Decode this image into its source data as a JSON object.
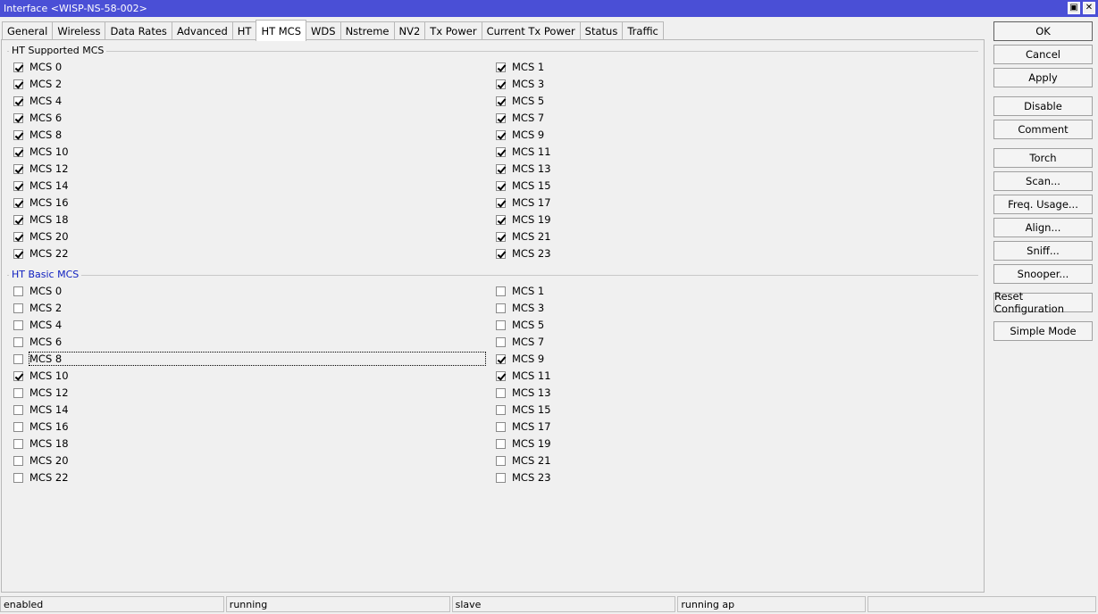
{
  "window": {
    "title": "Interface <WISP-NS-58-002>",
    "restore_glyph": "▣",
    "close_glyph": "✕"
  },
  "tabs": [
    {
      "label": "General",
      "active": false
    },
    {
      "label": "Wireless",
      "active": false
    },
    {
      "label": "Data Rates",
      "active": false
    },
    {
      "label": "Advanced",
      "active": false
    },
    {
      "label": "HT",
      "active": false
    },
    {
      "label": "HT MCS",
      "active": true
    },
    {
      "label": "WDS",
      "active": false
    },
    {
      "label": "Nstreme",
      "active": false
    },
    {
      "label": "NV2",
      "active": false
    },
    {
      "label": "Tx Power",
      "active": false
    },
    {
      "label": "Current Tx Power",
      "active": false
    },
    {
      "label": "Status",
      "active": false
    },
    {
      "label": "Traffic",
      "active": false
    }
  ],
  "supported": {
    "title": "HT Supported MCS",
    "items": [
      {
        "label": "MCS 0",
        "checked": true
      },
      {
        "label": "MCS 1",
        "checked": true
      },
      {
        "label": "MCS 2",
        "checked": true
      },
      {
        "label": "MCS 3",
        "checked": true
      },
      {
        "label": "MCS 4",
        "checked": true
      },
      {
        "label": "MCS 5",
        "checked": true
      },
      {
        "label": "MCS 6",
        "checked": true
      },
      {
        "label": "MCS 7",
        "checked": true
      },
      {
        "label": "MCS 8",
        "checked": true
      },
      {
        "label": "MCS 9",
        "checked": true
      },
      {
        "label": "MCS 10",
        "checked": true
      },
      {
        "label": "MCS 11",
        "checked": true
      },
      {
        "label": "MCS 12",
        "checked": true
      },
      {
        "label": "MCS 13",
        "checked": true
      },
      {
        "label": "MCS 14",
        "checked": true
      },
      {
        "label": "MCS 15",
        "checked": true
      },
      {
        "label": "MCS 16",
        "checked": true
      },
      {
        "label": "MCS 17",
        "checked": true
      },
      {
        "label": "MCS 18",
        "checked": true
      },
      {
        "label": "MCS 19",
        "checked": true
      },
      {
        "label": "MCS 20",
        "checked": true
      },
      {
        "label": "MCS 21",
        "checked": true
      },
      {
        "label": "MCS 22",
        "checked": true
      },
      {
        "label": "MCS 23",
        "checked": true
      }
    ]
  },
  "basic": {
    "title": "HT Basic MCS",
    "items": [
      {
        "label": "MCS 0",
        "checked": false
      },
      {
        "label": "MCS 1",
        "checked": false
      },
      {
        "label": "MCS 2",
        "checked": false
      },
      {
        "label": "MCS 3",
        "checked": false
      },
      {
        "label": "MCS 4",
        "checked": false
      },
      {
        "label": "MCS 5",
        "checked": false
      },
      {
        "label": "MCS 6",
        "checked": false
      },
      {
        "label": "MCS 7",
        "checked": false
      },
      {
        "label": "MCS 8",
        "checked": false,
        "focused": true
      },
      {
        "label": "MCS 9",
        "checked": true
      },
      {
        "label": "MCS 10",
        "checked": true
      },
      {
        "label": "MCS 11",
        "checked": true
      },
      {
        "label": "MCS 12",
        "checked": false
      },
      {
        "label": "MCS 13",
        "checked": false
      },
      {
        "label": "MCS 14",
        "checked": false
      },
      {
        "label": "MCS 15",
        "checked": false
      },
      {
        "label": "MCS 16",
        "checked": false
      },
      {
        "label": "MCS 17",
        "checked": false
      },
      {
        "label": "MCS 18",
        "checked": false
      },
      {
        "label": "MCS 19",
        "checked": false
      },
      {
        "label": "MCS 20",
        "checked": false
      },
      {
        "label": "MCS 21",
        "checked": false
      },
      {
        "label": "MCS 22",
        "checked": false
      },
      {
        "label": "MCS 23",
        "checked": false
      }
    ]
  },
  "buttons": [
    {
      "label": "OK",
      "primary": true
    },
    {
      "label": "Cancel"
    },
    {
      "label": "Apply"
    },
    {
      "label": "Disable"
    },
    {
      "label": "Comment"
    },
    {
      "label": "Torch"
    },
    {
      "label": "Scan..."
    },
    {
      "label": "Freq. Usage..."
    },
    {
      "label": "Align..."
    },
    {
      "label": "Sniff..."
    },
    {
      "label": "Snooper..."
    },
    {
      "label": "Reset Configuration"
    },
    {
      "label": "Simple Mode"
    }
  ],
  "status": [
    "enabled",
    "running",
    "slave",
    "running ap",
    ""
  ]
}
